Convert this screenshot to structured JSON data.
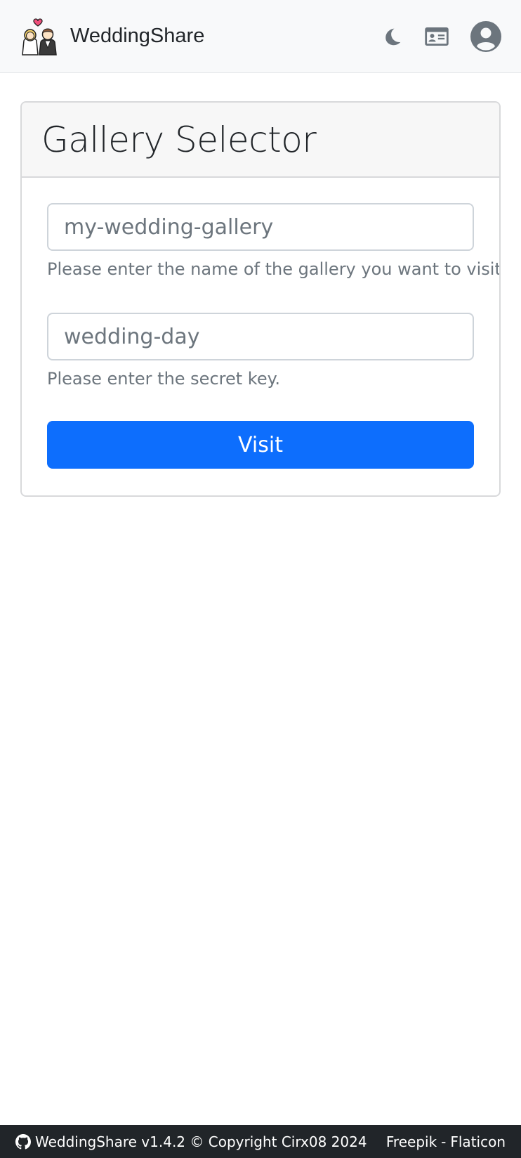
{
  "navbar": {
    "brand_name": "WeddingShare",
    "logo_icon": "bride-groom-logo-icon",
    "icons": [
      "moon-icon",
      "id-card-icon",
      "user-circle-icon"
    ]
  },
  "gallery_selector": {
    "title": "Gallery Selector",
    "gallery_field": {
      "placeholder": "my-wedding-gallery",
      "help": "Please enter the name of the gallery you want to visit."
    },
    "key_field": {
      "placeholder": "wedding-day",
      "help": "Please enter the secret key."
    },
    "visit_label": "Visit"
  },
  "footer": {
    "copyright": "WeddingShare v1.4.2 © Copyright Cirx08 2024",
    "credit_1": "Freepik",
    "separator": "-",
    "credit_2": "Flaticon"
  },
  "colors": {
    "primary": "#0d6efd",
    "navbar_bg": "#f8f9fa",
    "footer_bg": "#212529",
    "muted_text": "#6c757d"
  }
}
